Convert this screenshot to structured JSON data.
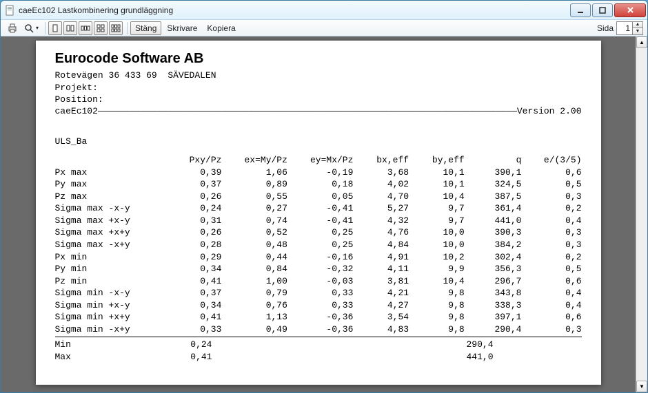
{
  "window": {
    "title": "caeEc102 Lastkombinering grundläggning"
  },
  "toolbar": {
    "close_label": "Stäng",
    "printer_label": "Skrivare",
    "copy_label": "Kopiera",
    "page_label": "Sida",
    "page_value": "1"
  },
  "doc": {
    "company": "Eurocode Software AB",
    "address_label": "Rotevägen 36 433 69  SÄVEDALEN",
    "project_label": "Projekt:",
    "position_label": "Position:",
    "module": "caeEc102",
    "version": "Version 2.00",
    "table_title": "ULS_Ba",
    "headers": [
      "",
      "Pxy/Pz",
      "ex=My/Pz",
      "ey=Mx/Pz",
      "bx,eff",
      "by,eff",
      "q",
      "e/(3/5)"
    ],
    "rows": [
      {
        "n": "Px max",
        "v": [
          "0,39",
          "1,06",
          "-0,19",
          "3,68",
          "10,1",
          "390,1",
          "0,6"
        ]
      },
      {
        "n": "Py max",
        "v": [
          "0,37",
          "0,89",
          "0,18",
          "4,02",
          "10,1",
          "324,5",
          "0,5"
        ]
      },
      {
        "n": "Pz max",
        "v": [
          "0,26",
          "0,55",
          "0,05",
          "4,70",
          "10,4",
          "387,5",
          "0,3"
        ]
      },
      {
        "n": "Sigma max -x-y",
        "v": [
          "0,24",
          "0,27",
          "-0,41",
          "5,27",
          "9,7",
          "361,4",
          "0,2"
        ]
      },
      {
        "n": "Sigma max +x-y",
        "v": [
          "0,31",
          "0,74",
          "-0,41",
          "4,32",
          "9,7",
          "441,0",
          "0,4"
        ]
      },
      {
        "n": "Sigma max +x+y",
        "v": [
          "0,26",
          "0,52",
          "0,25",
          "4,76",
          "10,0",
          "390,3",
          "0,3"
        ]
      },
      {
        "n": "Sigma max -x+y",
        "v": [
          "0,28",
          "0,48",
          "0,25",
          "4,84",
          "10,0",
          "384,2",
          "0,3"
        ]
      },
      {
        "n": "Px min",
        "v": [
          "0,29",
          "0,44",
          "-0,16",
          "4,91",
          "10,2",
          "302,4",
          "0,2"
        ]
      },
      {
        "n": "Py min",
        "v": [
          "0,34",
          "0,84",
          "-0,32",
          "4,11",
          "9,9",
          "356,3",
          "0,5"
        ]
      },
      {
        "n": "Pz min",
        "v": [
          "0,41",
          "1,00",
          "-0,03",
          "3,81",
          "10,4",
          "296,7",
          "0,6"
        ]
      },
      {
        "n": "Sigma min -x-y",
        "v": [
          "0,37",
          "0,79",
          "0,33",
          "4,21",
          "9,8",
          "343,8",
          "0,4"
        ]
      },
      {
        "n": "Sigma min +x-y",
        "v": [
          "0,34",
          "0,76",
          "0,33",
          "4,27",
          "9,8",
          "338,3",
          "0,4"
        ]
      },
      {
        "n": "Sigma min +x+y",
        "v": [
          "0,41",
          "1,13",
          "-0,36",
          "3,54",
          "9,8",
          "397,1",
          "0,6"
        ]
      },
      {
        "n": "Sigma min -x+y",
        "v": [
          "0,33",
          "0,49",
          "-0,36",
          "4,83",
          "9,8",
          "290,4",
          "0,3"
        ]
      }
    ],
    "summary": {
      "min_label": "Min",
      "min_c1": "0,24",
      "min_q": "290,4",
      "max_label": "Max",
      "max_c1": "0,41",
      "max_q": "441,0"
    }
  }
}
